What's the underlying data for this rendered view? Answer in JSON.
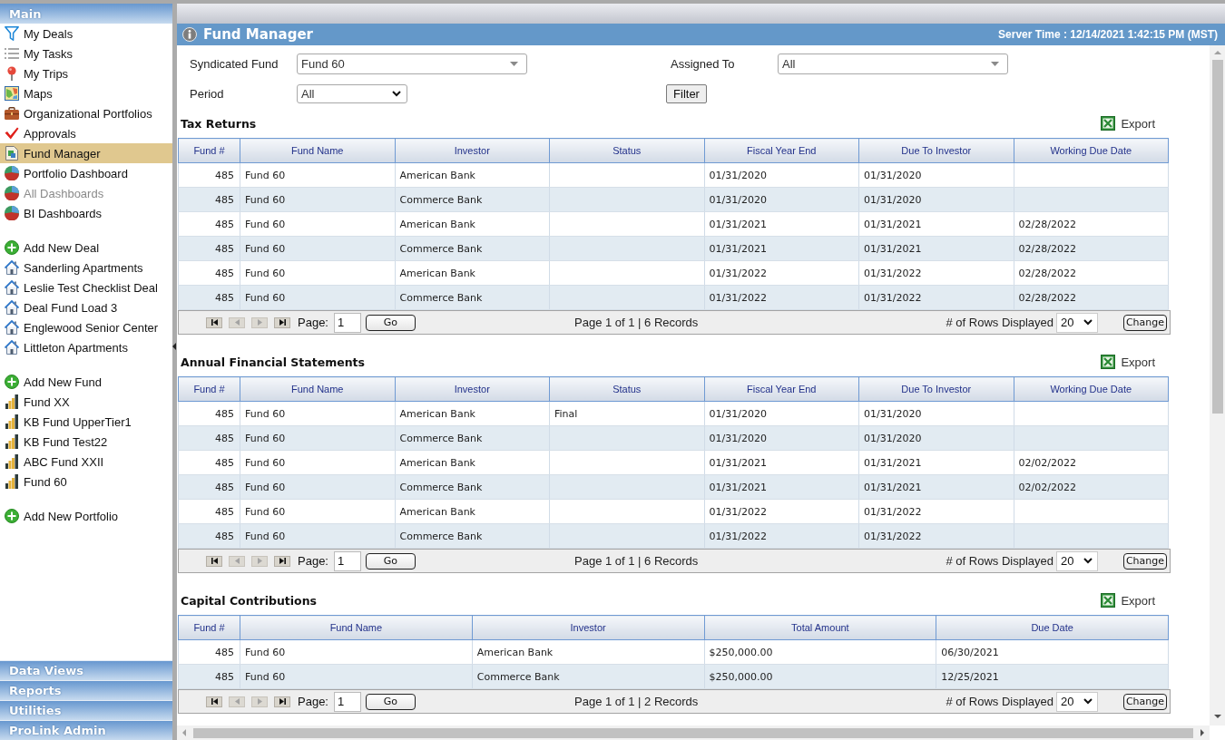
{
  "sidebar": {
    "header": "Main",
    "groups": [
      {
        "items": [
          {
            "label": "My Deals",
            "kind": "filter",
            "selected": false,
            "disabled": false
          },
          {
            "label": "My Tasks",
            "kind": "tasks",
            "selected": false,
            "disabled": false
          },
          {
            "label": "My Trips",
            "kind": "pin",
            "selected": false,
            "disabled": false
          },
          {
            "label": "Maps",
            "kind": "map",
            "selected": false,
            "disabled": false
          },
          {
            "label": "Organizational Portfolios",
            "kind": "briefcase",
            "selected": false,
            "disabled": false
          },
          {
            "label": "Approvals",
            "kind": "check",
            "selected": false,
            "disabled": false
          },
          {
            "label": "Fund Manager",
            "kind": "document",
            "selected": true,
            "disabled": false
          },
          {
            "label": "Portfolio Dashboard",
            "kind": "pie",
            "selected": false,
            "disabled": false
          },
          {
            "label": "All Dashboards",
            "kind": "pie",
            "selected": false,
            "disabled": true
          },
          {
            "label": "BI Dashboards",
            "kind": "pie",
            "selected": false,
            "disabled": false
          }
        ]
      },
      {
        "items": [
          {
            "label": "Add New Deal",
            "kind": "add",
            "selected": false,
            "disabled": false
          },
          {
            "label": "Sanderling Apartments",
            "kind": "house",
            "selected": false,
            "disabled": false
          },
          {
            "label": "Leslie Test Checklist Deal",
            "kind": "house",
            "selected": false,
            "disabled": false
          },
          {
            "label": "Deal Fund Load 3",
            "kind": "house",
            "selected": false,
            "disabled": false
          },
          {
            "label": "Englewood Senior Center",
            "kind": "house",
            "selected": false,
            "disabled": false
          },
          {
            "label": "Littleton Apartments",
            "kind": "house",
            "selected": false,
            "disabled": false
          }
        ]
      },
      {
        "items": [
          {
            "label": "Add New Fund",
            "kind": "add",
            "selected": false,
            "disabled": false
          },
          {
            "label": "Fund XX",
            "kind": "bars",
            "selected": false,
            "disabled": false
          },
          {
            "label": "KB Fund UpperTier1",
            "kind": "bars",
            "selected": false,
            "disabled": false
          },
          {
            "label": "KB Fund Test22",
            "kind": "bars",
            "selected": false,
            "disabled": false
          },
          {
            "label": "ABC Fund XXII",
            "kind": "bars",
            "selected": false,
            "disabled": false
          },
          {
            "label": "Fund 60",
            "kind": "bars",
            "selected": false,
            "disabled": false
          }
        ]
      },
      {
        "items": [
          {
            "label": "Add New Portfolio",
            "kind": "add",
            "selected": false,
            "disabled": false
          }
        ]
      }
    ],
    "sections": [
      "Data Views",
      "Reports",
      "Utilities",
      "ProLink Admin"
    ]
  },
  "main": {
    "title": "Fund Manager",
    "server_time": "Server Time : 12/14/2021 1:42:15 PM (MST)",
    "filters": [
      {
        "label": "Syndicated Fund",
        "value": "Fund 60",
        "kind": "combo"
      },
      {
        "label": "Assigned To",
        "value": "All",
        "kind": "combo"
      },
      {
        "label": "Period",
        "value": "All",
        "kind": "select"
      }
    ],
    "filter_button": "Filter",
    "grids": [
      {
        "title": "Tax Returns",
        "export": "Export",
        "columns": {
          "fund_no": "Fund #",
          "fund_name": "Fund Name",
          "investor": "Investor",
          "status": "Status",
          "fiscal_year_end": "Fiscal Year End",
          "due_to_investor": "Due To Investor",
          "working_due_date": "Working Due Date"
        },
        "rows": [
          {
            "fund_no": "485",
            "fund_name": "Fund 60",
            "investor": "American Bank",
            "fiscal_year_end": "01/31/2020",
            "due_to_investor": "01/31/2020"
          },
          {
            "fund_no": "485",
            "fund_name": "Fund 60",
            "investor": "Commerce Bank",
            "fiscal_year_end": "01/31/2020",
            "due_to_investor": "01/31/2020"
          },
          {
            "fund_no": "485",
            "fund_name": "Fund 60",
            "investor": "American Bank",
            "fiscal_year_end": "01/31/2021",
            "due_to_investor": "01/31/2021",
            "working_due_date": "02/28/2022"
          },
          {
            "fund_no": "485",
            "fund_name": "Fund 60",
            "investor": "Commerce Bank",
            "fiscal_year_end": "01/31/2021",
            "due_to_investor": "01/31/2021",
            "working_due_date": "02/28/2022"
          },
          {
            "fund_no": "485",
            "fund_name": "Fund 60",
            "investor": "American Bank",
            "fiscal_year_end": "01/31/2022",
            "due_to_investor": "01/31/2022",
            "working_due_date": "02/28/2022"
          },
          {
            "fund_no": "485",
            "fund_name": "Fund 60",
            "investor": "Commerce Bank",
            "fiscal_year_end": "01/31/2022",
            "due_to_investor": "01/31/2022",
            "working_due_date": "02/28/2022"
          }
        ],
        "pager": {
          "nav": [
            {
              "kind": "first",
              "disabled": false
            },
            {
              "kind": "prev",
              "disabled": true
            },
            {
              "kind": "next",
              "disabled": true
            },
            {
              "kind": "last",
              "disabled": false
            }
          ],
          "page_label": "Page:",
          "page": "1",
          "go": "Go",
          "summary": "Page 1 of 1 | 6 Records",
          "rows_label": "# of Rows Displayed",
          "rows_per_page": "20",
          "change": "Change"
        }
      },
      {
        "title": "Annual Financial Statements",
        "export": "Export",
        "columns": {
          "fund_no": "Fund #",
          "fund_name": "Fund Name",
          "investor": "Investor",
          "status": "Status",
          "fiscal_year_end": "Fiscal Year End",
          "due_to_investor": "Due To Investor",
          "working_due_date": "Working Due Date"
        },
        "rows": [
          {
            "fund_no": "485",
            "fund_name": "Fund 60",
            "investor": "American Bank",
            "status": "Final",
            "fiscal_year_end": "01/31/2020",
            "due_to_investor": "01/31/2020"
          },
          {
            "fund_no": "485",
            "fund_name": "Fund 60",
            "investor": "Commerce Bank",
            "fiscal_year_end": "01/31/2020",
            "due_to_investor": "01/31/2020"
          },
          {
            "fund_no": "485",
            "fund_name": "Fund 60",
            "investor": "American Bank",
            "fiscal_year_end": "01/31/2021",
            "due_to_investor": "01/31/2021",
            "working_due_date": "02/02/2022"
          },
          {
            "fund_no": "485",
            "fund_name": "Fund 60",
            "investor": "Commerce Bank",
            "fiscal_year_end": "01/31/2021",
            "due_to_investor": "01/31/2021",
            "working_due_date": "02/02/2022"
          },
          {
            "fund_no": "485",
            "fund_name": "Fund 60",
            "investor": "American Bank",
            "fiscal_year_end": "01/31/2022",
            "due_to_investor": "01/31/2022"
          },
          {
            "fund_no": "485",
            "fund_name": "Fund 60",
            "investor": "Commerce Bank",
            "fiscal_year_end": "01/31/2022",
            "due_to_investor": "01/31/2022"
          }
        ],
        "pager": {
          "nav": [
            {
              "kind": "first",
              "disabled": false
            },
            {
              "kind": "prev",
              "disabled": true
            },
            {
              "kind": "next",
              "disabled": true
            },
            {
              "kind": "last",
              "disabled": false
            }
          ],
          "page_label": "Page:",
          "page": "1",
          "go": "Go",
          "summary": "Page 1 of 1 | 6 Records",
          "rows_label": "# of Rows Displayed",
          "rows_per_page": "20",
          "change": "Change"
        }
      },
      {
        "title": "Capital Contributions",
        "export": "Export",
        "columns": {
          "fund_no": "Fund #",
          "fund_name": "Fund Name",
          "investor": "Investor",
          "total_amount": "Total Amount",
          "due_date": "Due Date"
        },
        "rows": [
          {
            "fund_no": "485",
            "fund_name": "Fund 60",
            "investor": "American Bank",
            "total_amount": "$250,000.00",
            "due_date": "06/30/2021"
          },
          {
            "fund_no": "485",
            "fund_name": "Fund 60",
            "investor": "Commerce Bank",
            "total_amount": "$250,000.00",
            "due_date": "12/25/2021"
          }
        ],
        "pager": {
          "nav": [
            {
              "kind": "first",
              "disabled": false
            },
            {
              "kind": "prev",
              "disabled": true
            },
            {
              "kind": "next",
              "disabled": true
            },
            {
              "kind": "last",
              "disabled": false
            }
          ],
          "page_label": "Page:",
          "page": "1",
          "go": "Go",
          "summary": "Page 1 of 1 | 2 Records",
          "rows_label": "# of Rows Displayed",
          "rows_per_page": "20",
          "change": "Change"
        }
      }
    ]
  }
}
